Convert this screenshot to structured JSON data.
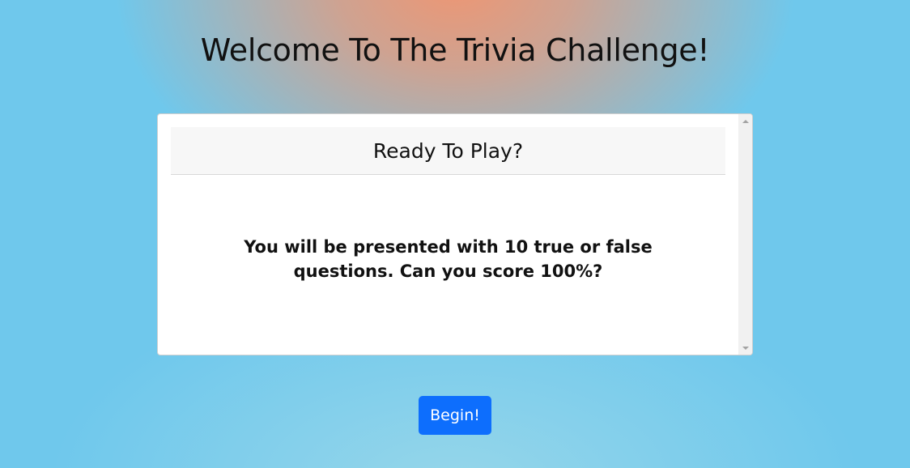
{
  "page": {
    "title": "Welcome To The Trivia Challenge!"
  },
  "card": {
    "header": "Ready To Play?",
    "body": "You will be presented with 10 true or false questions. Can you score 100%?"
  },
  "actions": {
    "begin_label": "Begin!"
  },
  "colors": {
    "primary_button": "#0d6efd",
    "background_blue": "#6fc8ec",
    "background_glow": "#ee9673"
  }
}
